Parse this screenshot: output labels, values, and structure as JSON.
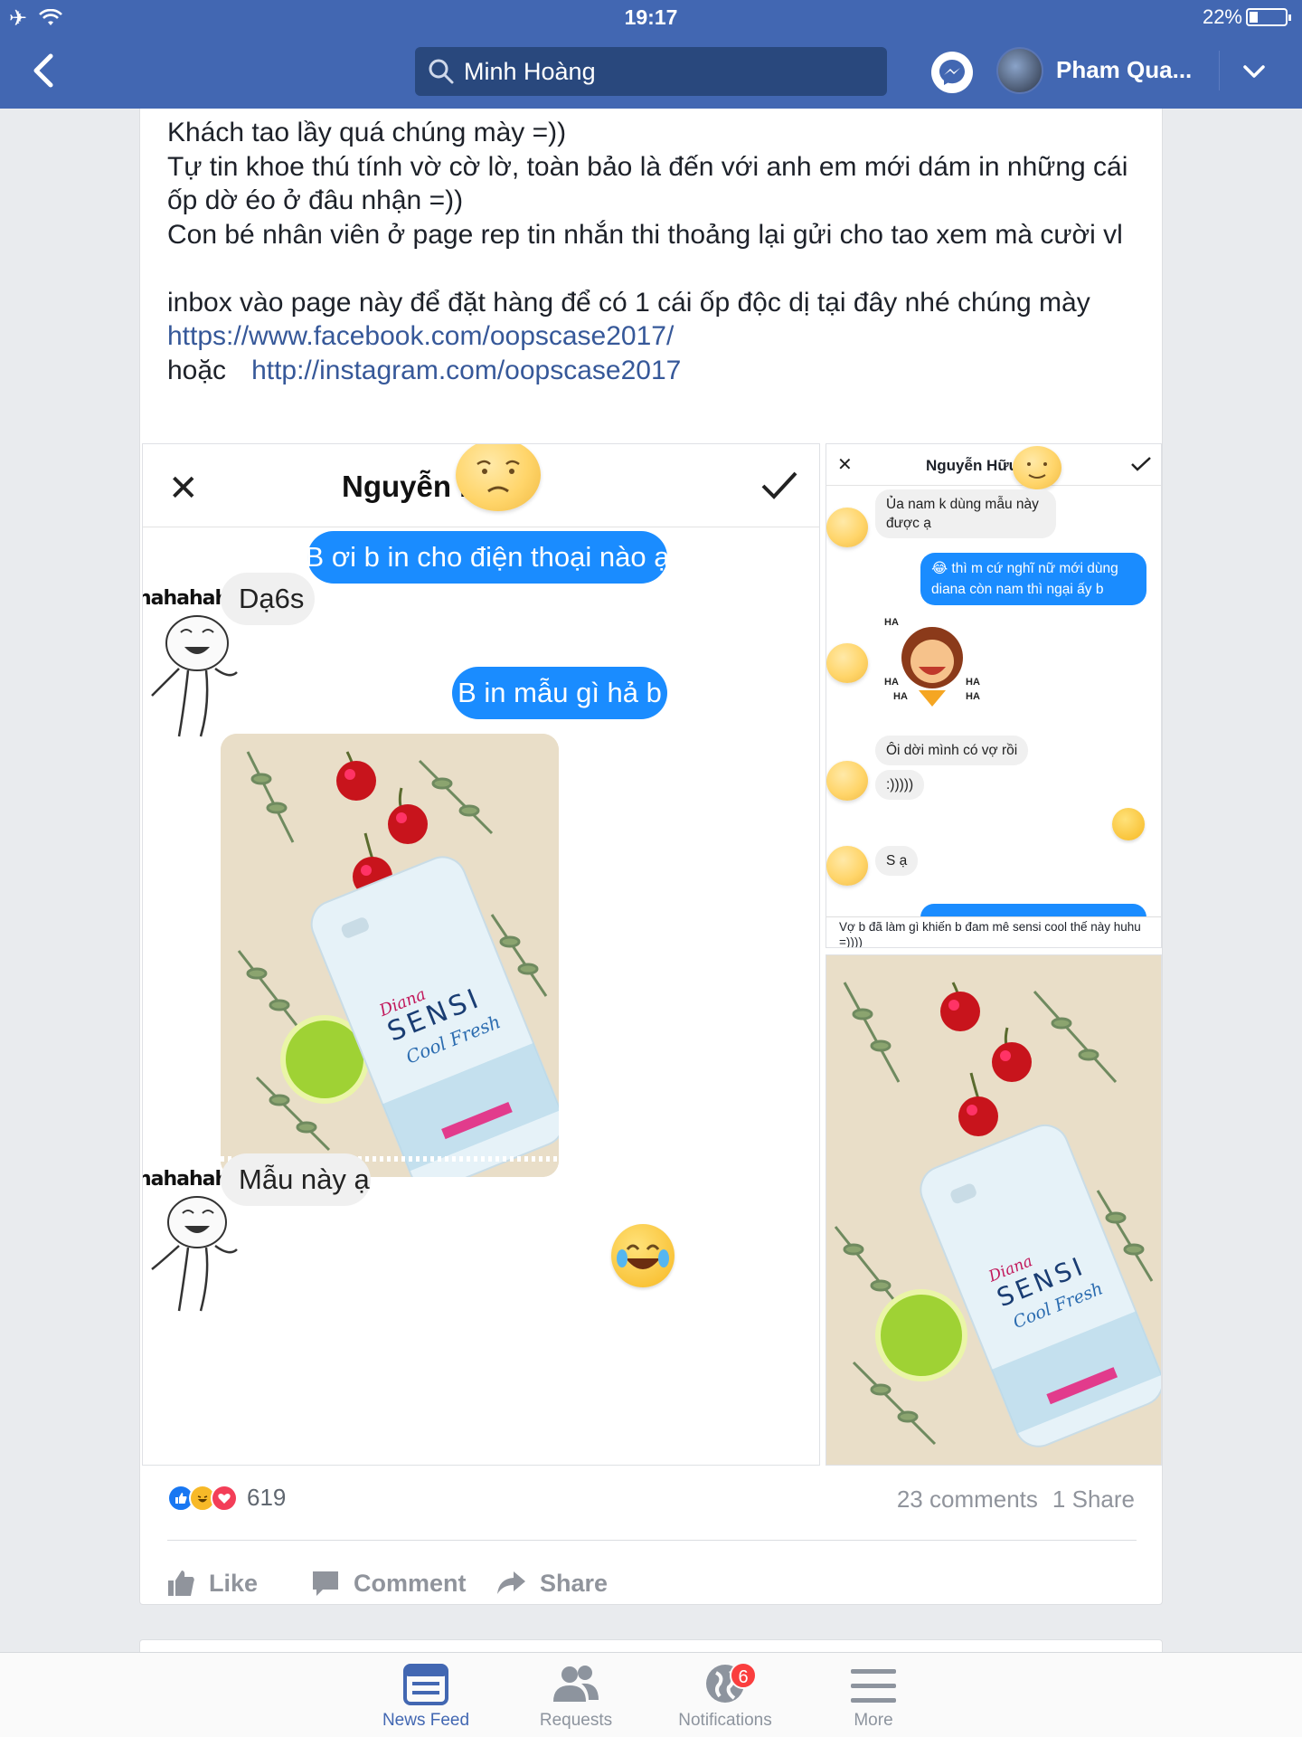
{
  "status_bar": {
    "time": "19:17",
    "battery": "22%",
    "battery_level": 0.22
  },
  "nav": {
    "search_value": "Minh Hoàng",
    "profile_name": "Pham Qua..."
  },
  "post": {
    "lines": [
      "Khách tao lầy quá chúng mày =))",
      "Tự tin khoe thú tính vờ cờ lờ, toàn bảo là đến với anh em mới dám in những cái ốp dờ éo ở đâu nhận =))",
      "Con bé nhân viên ở page rep tin nhắn thi thoảng lại gửi cho tao xem mà cười vl",
      ""
    ],
    "link_intro": "inbox vào page này để đặt hàng để có 1 cái ốp độc dị tại đây nhé chúng mày ",
    "link_facebook": "https://www.facebook.com/oopscase2017/",
    "link_joiner": " hoặc",
    "link_instagram": "http://instagram.com/oopscase2017"
  },
  "chat_left": {
    "contact_name": "Nguyễn Hữu",
    "msg_1": "B ơi b in cho điện thoại nào ạ",
    "sticker_caption_1": "hahahaha",
    "msg_2": "Dạ6s",
    "msg_3": "B in mẫu gì hả b",
    "sticker_caption_2": "hahahaha",
    "msg_4": "Mẫu này ạ"
  },
  "chat_right": {
    "contact_name": "Nguyễn Hữu",
    "msg_1": "Ủa nam k dùng mẫu này được ạ",
    "msg_2": "😂 thì m cứ nghĩ nữ mới dùng diana còn nam thì ngại ấy b",
    "sticker_text": "HA",
    "msg_3": "Ôi dời mình có vợ rồi",
    "msg_4": ":)))))",
    "msg_5": "S ạ",
    "caption": "Vợ b đã làm gì khiến b đam mê sensi cool thế này huhu =))))"
  },
  "product": {
    "brand": "Diana",
    "name": "SENSI",
    "variant": "Cool Fresh"
  },
  "reactions": {
    "count": "619",
    "comments": "23 comments",
    "shares": "1 Share"
  },
  "actions": {
    "like": "Like",
    "comment": "Comment",
    "share": "Share"
  },
  "tabs": [
    {
      "label": "News Feed"
    },
    {
      "label": "Requests"
    },
    {
      "label": "Notifications",
      "badge": "6"
    },
    {
      "label": "More"
    }
  ],
  "colors": {
    "facebook_blue": "#4267b2",
    "messenger_blue": "#1a8cff",
    "link": "#365899",
    "badge_red": "#fa3e3e"
  }
}
